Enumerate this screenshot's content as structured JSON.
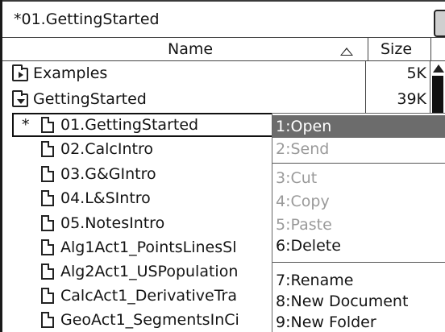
{
  "window": {
    "title": "*01.GettingStarted"
  },
  "columns": {
    "name": "Name",
    "size": "Size"
  },
  "folders": [
    {
      "name": "Examples",
      "size": "5K"
    },
    {
      "name": "GettingStarted",
      "size": "39K"
    }
  ],
  "files": [
    {
      "marker": "*",
      "name": "01.GettingStarted"
    },
    {
      "name": "02.CalcIntro"
    },
    {
      "name": "03.G&GIntro"
    },
    {
      "name": "04.L&SIntro"
    },
    {
      "name": "05.NotesIntro"
    },
    {
      "name": "Alg1Act1_PointsLinesSl"
    },
    {
      "name": "Alg2Act1_USPopulation"
    },
    {
      "name": "CalcAct1_DerivativeTra"
    },
    {
      "name": "GeoAct1_SegmentsInCi"
    }
  ],
  "context_menu": {
    "items": [
      {
        "label": "1:Open",
        "state": "active"
      },
      {
        "label": "2:Send",
        "state": "disabled"
      },
      {
        "label": "3:Cut",
        "state": "disabled"
      },
      {
        "label": "4:Copy",
        "state": "disabled"
      },
      {
        "label": "5:Paste",
        "state": "disabled"
      },
      {
        "label": "6:Delete",
        "state": "enabled"
      },
      {
        "label": "7:Rename",
        "state": "enabled"
      },
      {
        "label": "8:New Document",
        "state": "enabled"
      },
      {
        "label": "9:New Folder",
        "state": "enabled"
      }
    ]
  },
  "icons": {
    "folder_closed": "folder-closed-icon",
    "folder_open": "folder-open-icon",
    "document": "document-icon",
    "sort_ascending": "sort-ascending-icon",
    "battery": "battery-icon",
    "scroll_up": "scroll-up-arrow-icon"
  },
  "colors": {
    "menu_highlight": "#6c6c6c",
    "disabled_text": "#9a9a9a"
  }
}
